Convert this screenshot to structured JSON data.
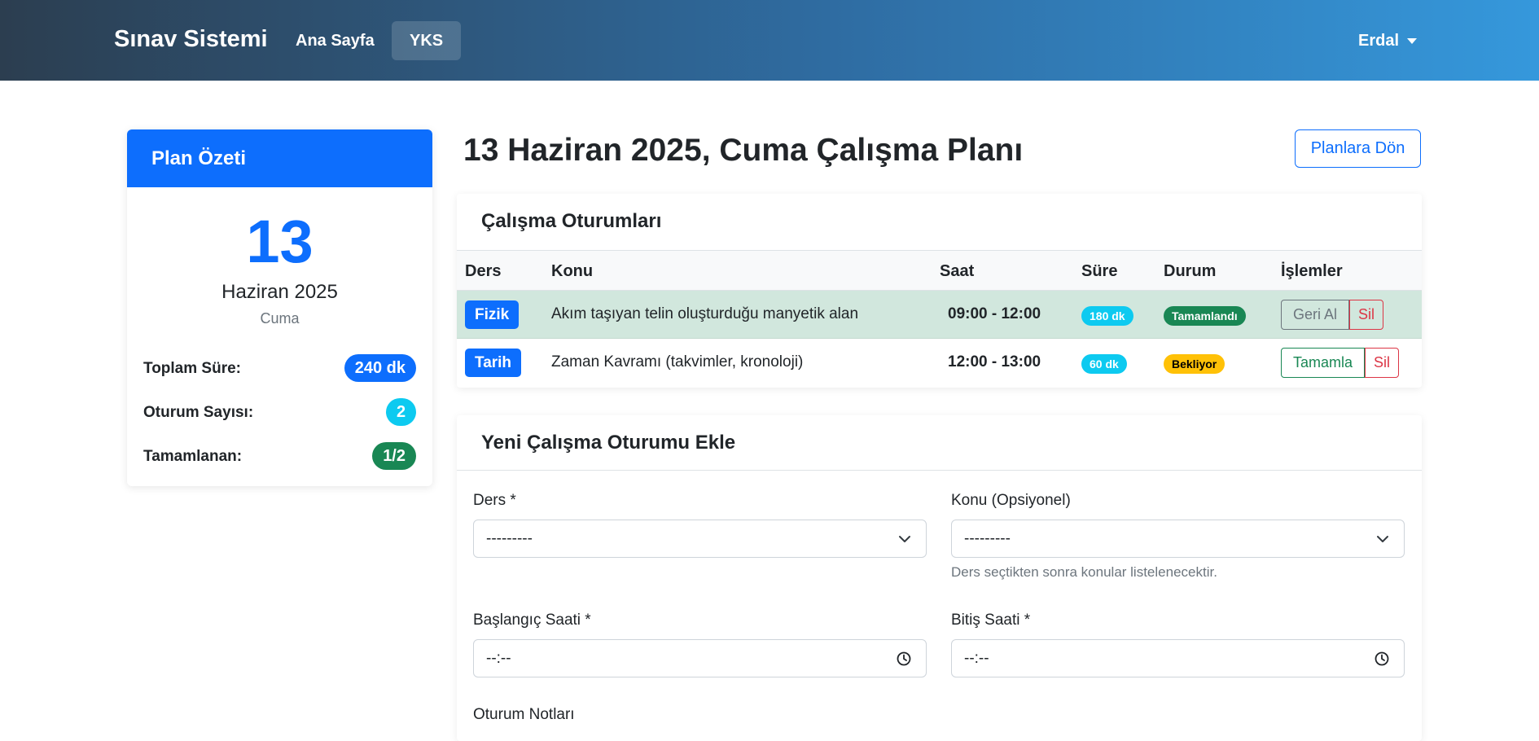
{
  "navbar": {
    "brand": "Sınav Sistemi",
    "links": [
      "Ana Sayfa",
      "YKS"
    ],
    "user": "Erdal"
  },
  "summary": {
    "header": "Plan Özeti",
    "day": "13",
    "month_year": "Haziran 2025",
    "weekday": "Cuma",
    "stats": [
      {
        "label": "Toplam Süre:",
        "value": "240 dk",
        "color": "#0d6efd"
      },
      {
        "label": "Oturum Sayısı:",
        "value": "2",
        "color": "#0dcaf0"
      },
      {
        "label": "Tamamlanan:",
        "value": "1/2",
        "color": "#198754"
      }
    ]
  },
  "page": {
    "title": "13 Haziran 2025, Cuma Çalışma Planı",
    "back_button": "Planlara Dön"
  },
  "sessions": {
    "title": "Çalışma Oturumları",
    "columns": [
      "Ders",
      "Konu",
      "Saat",
      "Süre",
      "Durum",
      "İşlemler"
    ],
    "rows": [
      {
        "subject": "Fizik",
        "topic": "Akım taşıyan telin oluşturduğu manyetik alan",
        "time": "09:00 - 12:00",
        "duration": "180 dk",
        "status": "Tamamlandı",
        "action": "Geri Al",
        "delete": "Sil"
      },
      {
        "subject": "Tarih",
        "topic": "Zaman Kavramı (takvimler, kronoloji)",
        "time": "12:00 - 13:00",
        "duration": "60 dk",
        "status": "Bekliyor",
        "action": "Tamamla",
        "delete": "Sil"
      }
    ]
  },
  "form": {
    "title": "Yeni Çalışma Oturumu Ekle",
    "subject_label": "Ders *",
    "subject_value": "---------",
    "topic_label": "Konu (Opsiyonel)",
    "topic_value": "---------",
    "topic_hint": "Ders seçtikten sonra konular listelenecektir.",
    "start_label": "Başlangıç Saati *",
    "start_value": "--:--",
    "end_label": "Bitiş Saati *",
    "end_value": "--:--",
    "notes_label": "Oturum Notları"
  }
}
